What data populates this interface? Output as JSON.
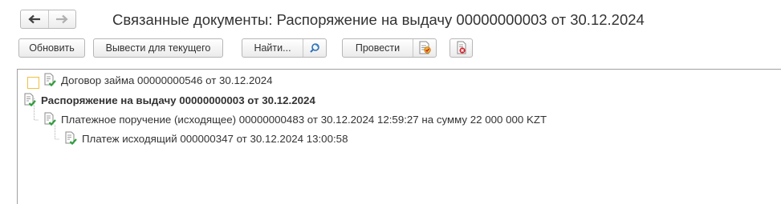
{
  "nav": {
    "back_icon": "arrow-left-icon",
    "forward_icon": "arrow-right-icon"
  },
  "window": {
    "title": "Связанные документы: Распоряжение на выдачу 00000000003 от 30.12.2024"
  },
  "toolbar": {
    "refresh_label": "Обновить",
    "show_current_label": "Вывести для текущего",
    "find_label": "Найти...",
    "find_icon": "search-refresh-icon",
    "post_label": "Провести",
    "post_icon": "post-document-icon",
    "unpost_icon": "unpost-document-icon"
  },
  "tree": {
    "items": [
      {
        "label": "Договор займа 00000000546 от 30.12.2024",
        "level": 1,
        "bold": false
      },
      {
        "label": "Распоряжение на выдачу 00000000003 от 30.12.2024",
        "level": 0,
        "bold": true
      },
      {
        "label": "Платежное поручение (исходящее) 00000000483 от 30.12.2024 12:59:27 на сумму 22 000 000 KZT",
        "level": 1,
        "bold": false
      },
      {
        "label": "Платеж исходящий 000000347 от 30.12.2024 13:00:58",
        "level": 2,
        "bold": false
      }
    ]
  },
  "colors": {
    "accent_check": "#2e9e3a",
    "selection_border": "#f0c040",
    "text": "#333333"
  }
}
